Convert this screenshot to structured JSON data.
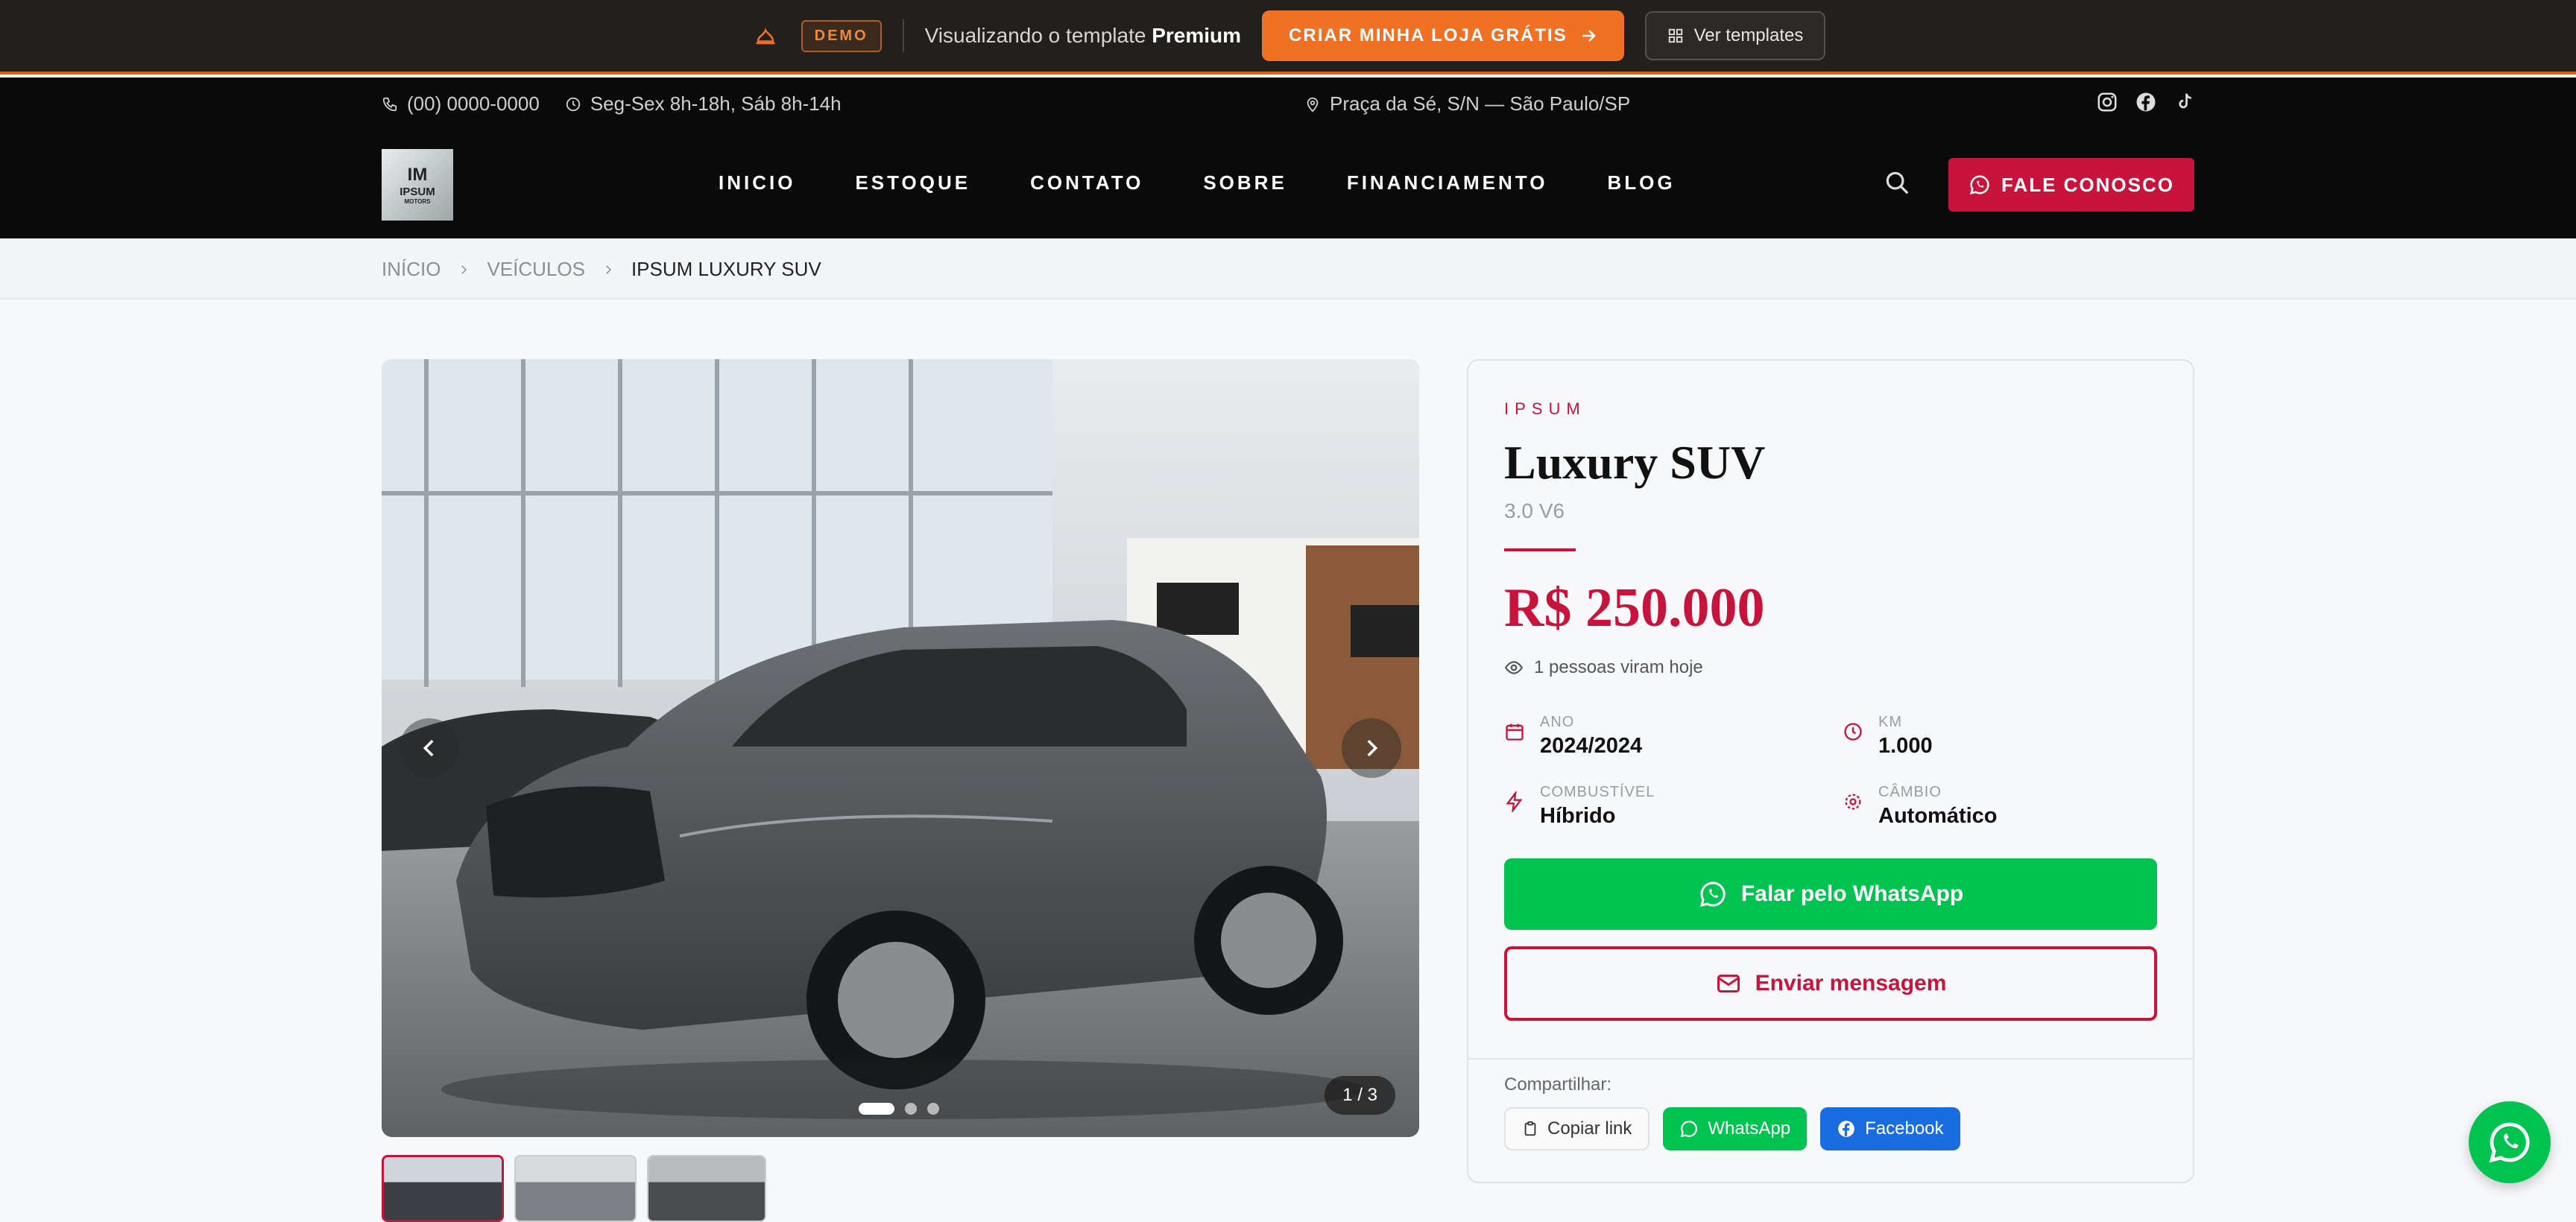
{
  "demo_bar": {
    "badge": "DEMO",
    "text_prefix": "Visualizando o template",
    "text_strong": "Premium",
    "create_button": "CRIAR MINHA LOJA GRÁTIS",
    "templates_button": "Ver templates"
  },
  "topbar": {
    "phone": "(00) 0000-0000",
    "hours": "Seg-Sex 8h-18h, Sáb 8h-14h",
    "address": "Praça da Sé, S/N — São Paulo/SP",
    "social_icons": [
      "instagram-icon",
      "facebook-icon",
      "tiktok-icon"
    ]
  },
  "logo": {
    "mark": "IM",
    "name": "IPSUM",
    "sub": "MOTORS"
  },
  "nav": {
    "items": [
      "INICIO",
      "ESTOQUE",
      "CONTATO",
      "SOBRE",
      "FINANCIAMENTO",
      "BLOG"
    ],
    "contact_button": "FALE CONOSCO"
  },
  "breadcrumb": {
    "items": [
      "INÍCIO",
      "VEÍCULOS",
      "IPSUM LUXURY SUV"
    ]
  },
  "gallery": {
    "counter": "1 / 3",
    "total": 3,
    "current": 1
  },
  "vehicle": {
    "brand": "IPSUM",
    "model": "Luxury SUV",
    "version": "3.0 V6",
    "price": "R$ 250.000",
    "views": "1 pessoas viram hoje",
    "specs": {
      "year_label": "ANO",
      "year": "2024/2024",
      "km_label": "KM",
      "km": "1.000",
      "fuel_label": "COMBUSTÍVEL",
      "fuel": "Híbrido",
      "gear_label": "CÂMBIO",
      "gear": "Automático"
    },
    "whatsapp_button": "Falar pelo WhatsApp",
    "message_button": "Enviar mensagem"
  },
  "share": {
    "label": "Compartilhar:",
    "copy": "Copiar link",
    "whatsapp": "WhatsApp",
    "facebook": "Facebook"
  },
  "colors": {
    "accent": "#c8143c",
    "whatsapp": "#00c44f",
    "facebook": "#1a6de0",
    "demo_orange": "#f07024"
  }
}
